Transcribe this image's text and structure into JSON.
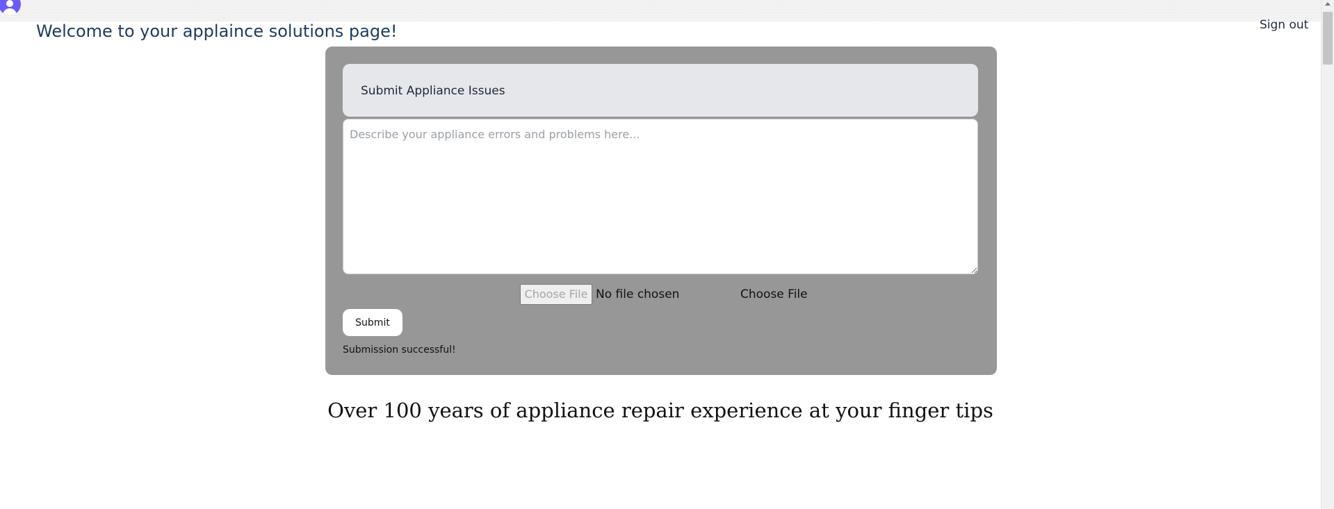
{
  "header": {
    "welcome_text": "Welcome to your applaince solutions page!",
    "sign_out_label": "Sign out",
    "avatar_icon": "user-avatar-icon",
    "avatar_color": "#6b5cf6"
  },
  "issue_form": {
    "title": "Submit Appliance Issues",
    "textarea_value": "",
    "textarea_placeholder": "Describe your appliance errors and problems here...",
    "file_button_label": "Choose File",
    "file_status": "No file chosen",
    "file_label": "Choose File",
    "submit_label": "Submit",
    "success_message": "Submission successful!",
    "panel_color": "#979797"
  },
  "tagline": "Over 100 years of appliance repair experience at your finger tips"
}
